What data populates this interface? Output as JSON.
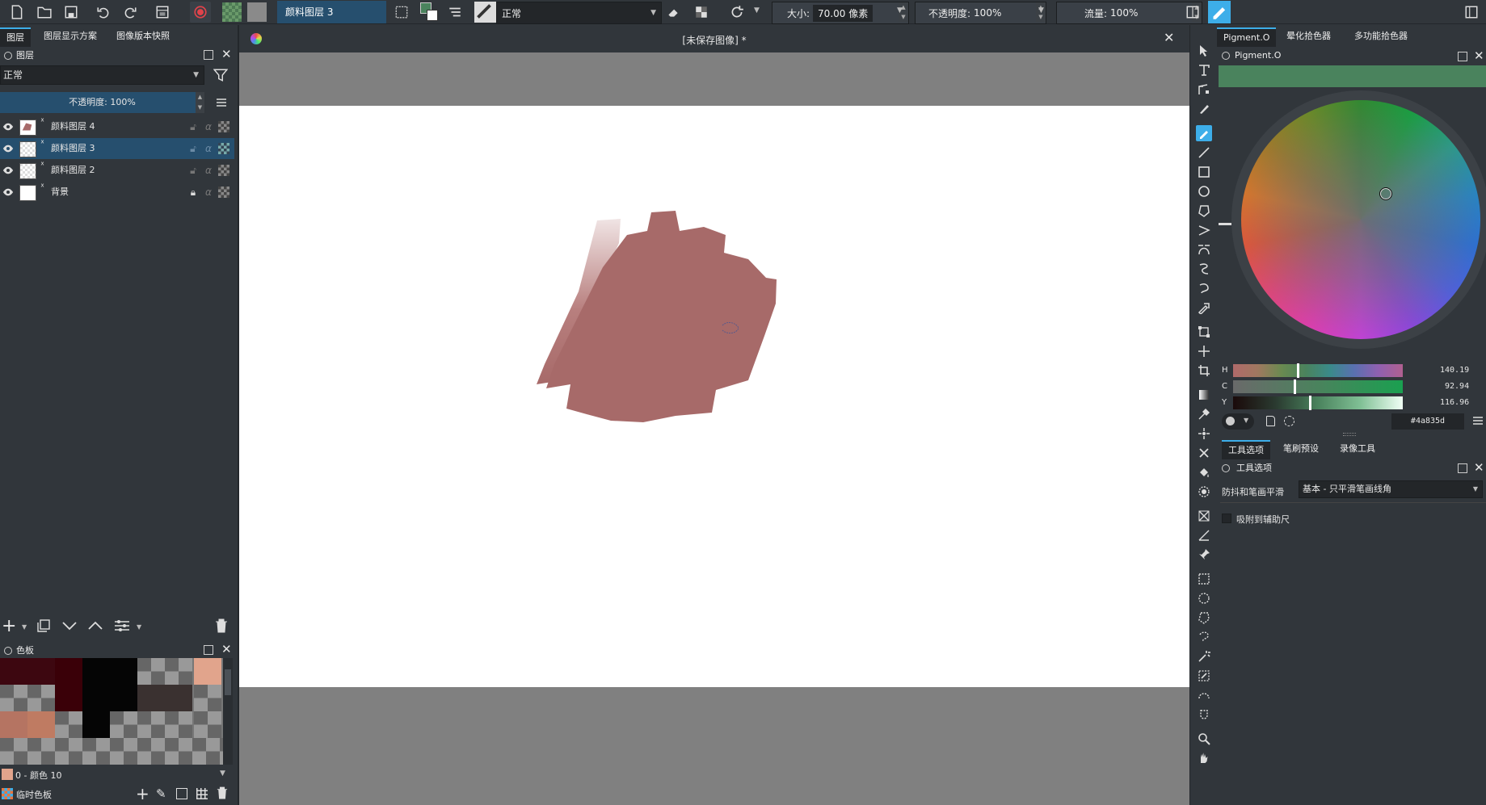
{
  "toolbar": {
    "layer_name": "颜料图层 3",
    "blend_mode": "正常",
    "size_label": "大小:",
    "size_value": "70.00 像素",
    "opacity_label": "不透明度:",
    "opacity_value": "100%",
    "flow_label": "流量:",
    "flow_value": "100%"
  },
  "left_tabs": [
    "图层",
    "图层显示方案",
    "图像版本快照"
  ],
  "layers_panel": {
    "title": "图层",
    "blend_mode": "正常",
    "opacity_label": "不透明度:  100%",
    "layers": [
      {
        "name": "颜料图层 4",
        "selected": false,
        "locked": false
      },
      {
        "name": "颜料图层 3",
        "selected": true,
        "locked": false
      },
      {
        "name": "颜料图层 2",
        "selected": false,
        "locked": false
      },
      {
        "name": "背景",
        "selected": false,
        "locked": true
      }
    ]
  },
  "palette_panel": {
    "title": "色板",
    "selected_color_label": "0 - 颜色 10",
    "palette_name": "临时色板"
  },
  "canvas": {
    "tab_title": "[未保存图像]  *",
    "stroke_color": "#a76a69"
  },
  "right_tabs": [
    "Pigment.O",
    "晕化拾色器",
    "多功能拾色器"
  ],
  "pigment_panel": {
    "title": "Pigment.O",
    "current_color": "#4a835d",
    "hex_label": "#4a835d",
    "sliders": [
      {
        "label": "H",
        "value": "140.19",
        "fraction": 0.38
      },
      {
        "label": "C",
        "value": "92.94",
        "fraction": 0.36
      },
      {
        "label": "Y",
        "value": "116.96",
        "fraction": 0.45
      }
    ]
  },
  "tool_options_tabs": [
    "工具选项",
    "笔刷预设",
    "录像工具"
  ],
  "tool_options": {
    "title": "工具选项",
    "smoothing_label": "防抖和笔画平滑",
    "smoothing_value": "基本 - 只平滑笔画线角",
    "snap_label": "吸附到辅助尺"
  }
}
